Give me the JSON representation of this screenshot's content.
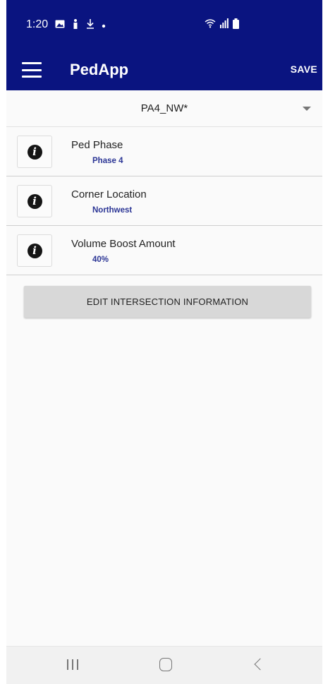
{
  "status_bar": {
    "time": "1:20",
    "left_icons": [
      "gallery-icon",
      "accessibility-icon",
      "download-icon",
      "dot-icon"
    ],
    "right_icons": [
      "wifi-icon",
      "signal-icon",
      "battery-icon"
    ]
  },
  "app_bar": {
    "title": "PedApp",
    "save_label": "SAVE",
    "background_color": "#0a1480"
  },
  "dropdown": {
    "selected": "PA4_NW*"
  },
  "rows": [
    {
      "label": "Ped Phase",
      "value": "Phase 4"
    },
    {
      "label": "Corner Location",
      "value": "Northwest"
    },
    {
      "label": "Volume Boost Amount",
      "value": "40%"
    }
  ],
  "edit_button": {
    "label": "EDIT INTERSECTION INFORMATION"
  },
  "colors": {
    "value_text": "#2b3595",
    "info_icon": "#151515"
  }
}
